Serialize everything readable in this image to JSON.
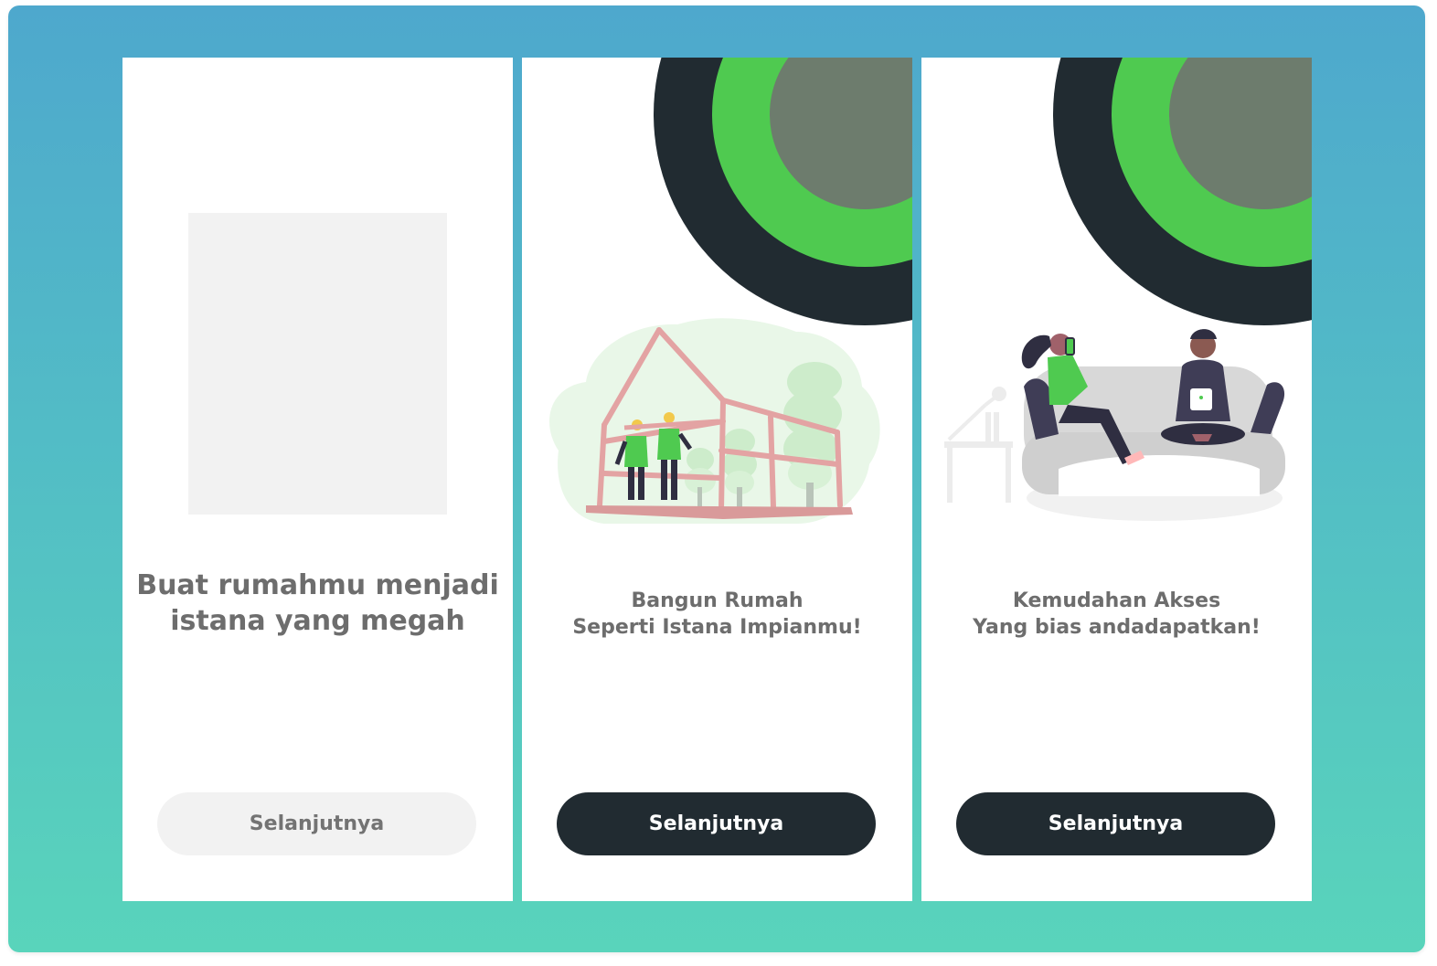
{
  "colors": {
    "background_top": "#4ea8cd",
    "background_bottom": "#59d4bb",
    "dark": "#212b31",
    "green": "#4fca50",
    "grey_disc": "#6d7c6d",
    "text_grey": "#6d6d6d"
  },
  "screens": [
    {
      "title_line1": "Buat rumahmu menjadi",
      "title_line2": "istana yang megah",
      "button_label": "Selanjutnya",
      "button_state": "disabled"
    },
    {
      "title_line1": "Bangun Rumah",
      "title_line2": "Seperti Istana Impianmu!",
      "button_label": "Selanjutnya",
      "button_state": "primary",
      "illustration": "house-construction-illustration"
    },
    {
      "title_line1": "Kemudahan Akses",
      "title_line2": "Yang bias andadapatkan!",
      "button_label": "Selanjutnya",
      "button_state": "primary",
      "illustration": "people-on-sofa-illustration"
    }
  ]
}
